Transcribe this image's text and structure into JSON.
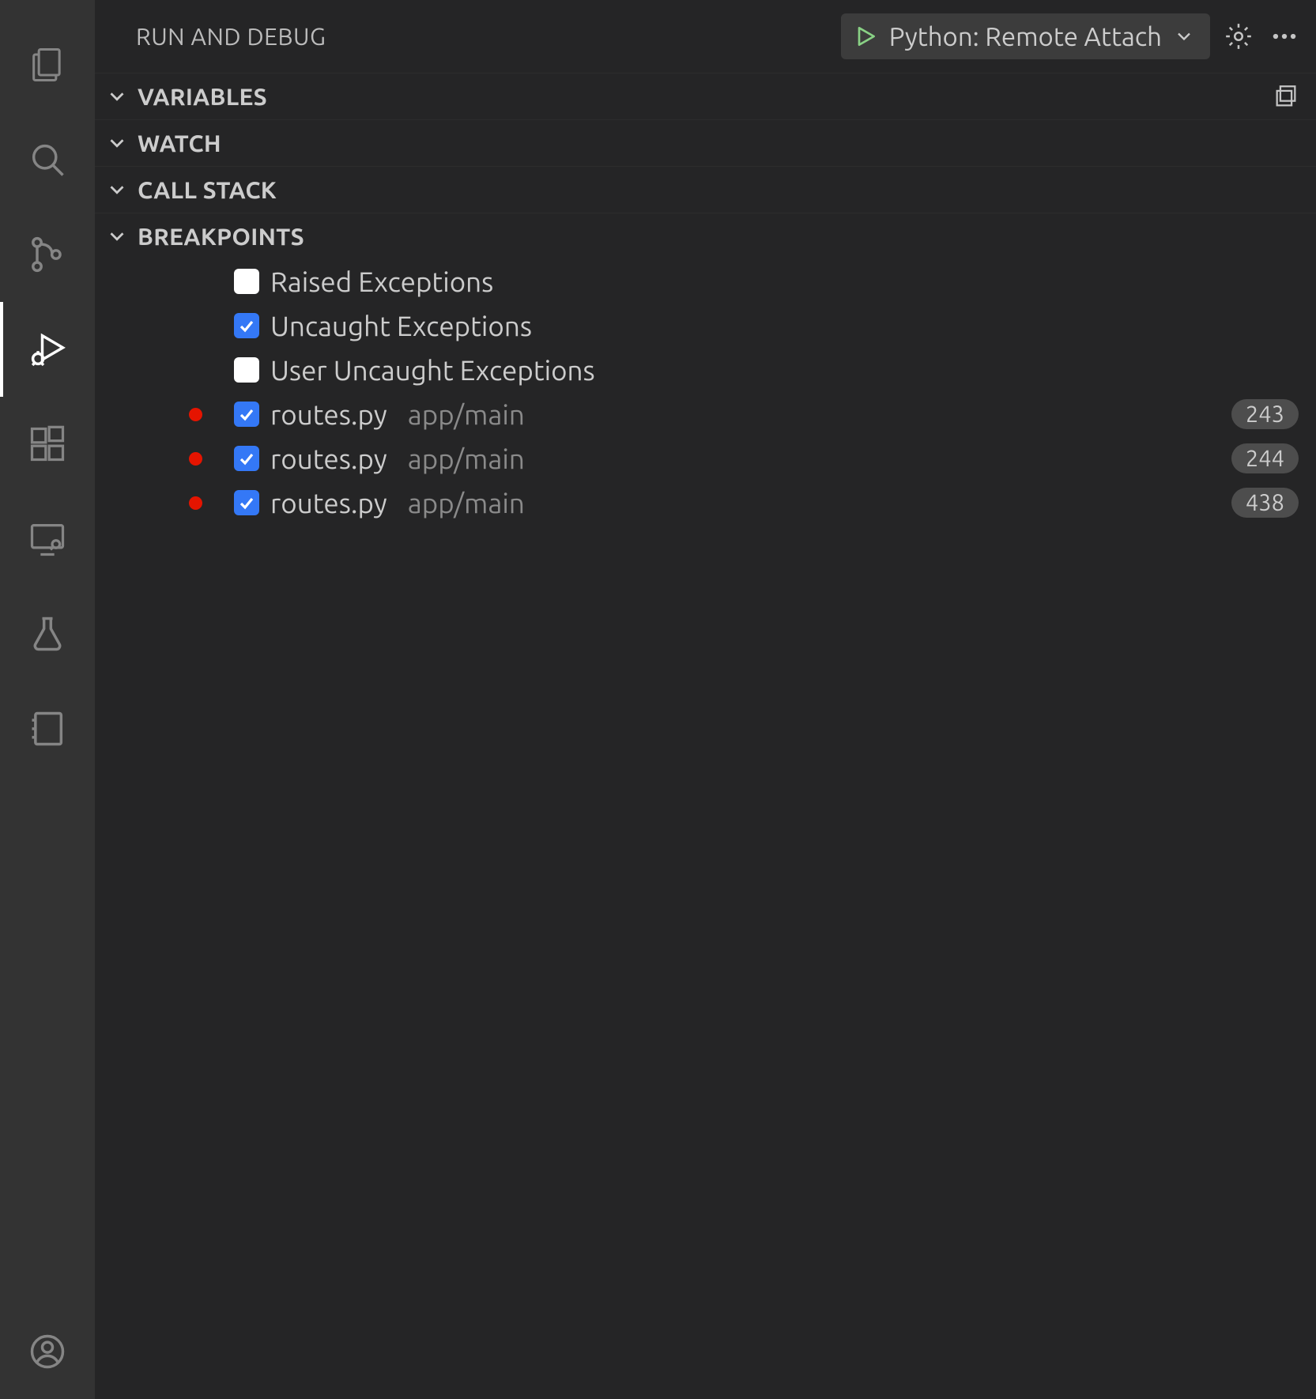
{
  "header": {
    "title": "RUN AND DEBUG",
    "config_label": "Python: Remote Attach"
  },
  "sections": {
    "variables": "VARIABLES",
    "watch": "WATCH",
    "callstack": "CALL STACK",
    "breakpoints": "BREAKPOINTS"
  },
  "breakpoints": {
    "exceptions": [
      {
        "label": "Raised Exceptions",
        "checked": false
      },
      {
        "label": "Uncaught Exceptions",
        "checked": true
      },
      {
        "label": "User Uncaught Exceptions",
        "checked": false
      }
    ],
    "files": [
      {
        "file": "routes.py",
        "path": "app/main",
        "line": "243",
        "checked": true
      },
      {
        "file": "routes.py",
        "path": "app/main",
        "line": "244",
        "checked": true
      },
      {
        "file": "routes.py",
        "path": "app/main",
        "line": "438",
        "checked": true
      }
    ]
  },
  "activity": {
    "explorer": "explorer",
    "search": "search",
    "scm": "source-control",
    "debug": "run-and-debug",
    "extensions": "extensions",
    "remote": "remote-explorer",
    "testing": "testing",
    "notebook": "notebook",
    "account": "account"
  }
}
